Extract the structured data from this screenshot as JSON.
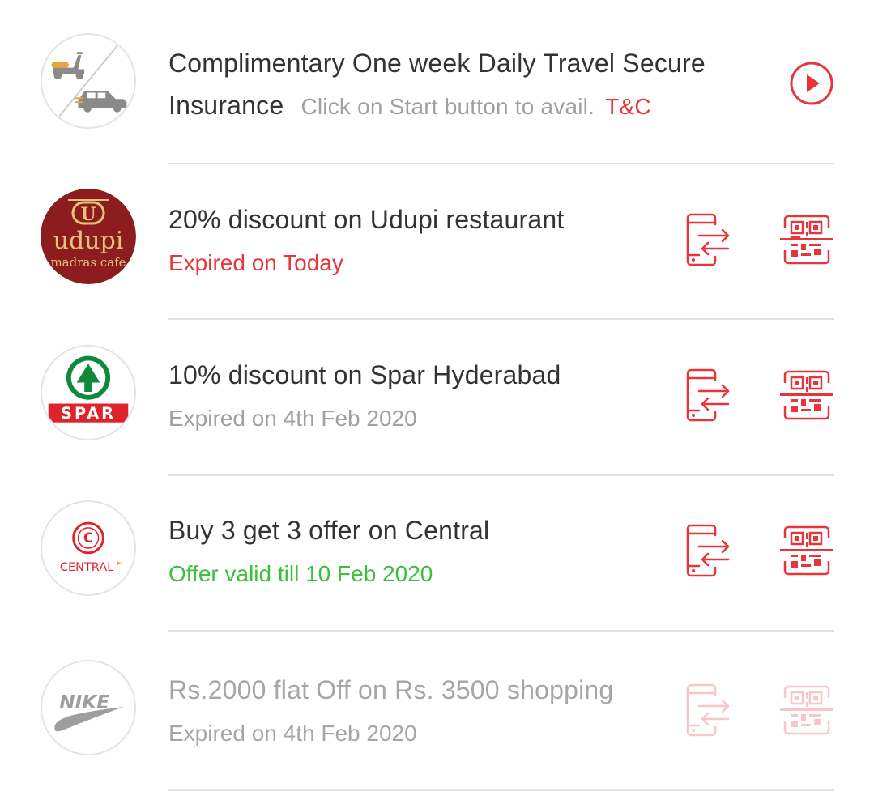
{
  "colors": {
    "accent": "#e8353b",
    "muted": "#a0a0a0",
    "valid": "#3cbf3c",
    "title": "#333333"
  },
  "offers": [
    {
      "logo": "travel-insurance-logo",
      "title_line1": "Complimentary One week Daily Travel Secure",
      "title_line2": "Insurance",
      "note": "Click on Start button to avail.",
      "tnc": "T&C",
      "action_icon": "play-icon"
    },
    {
      "logo": "udupi-logo",
      "logo_text_main": "udupi",
      "logo_text_sub": "madras cafe",
      "title": "20% discount on Udupi restaurant",
      "status": "Expired on Today",
      "status_kind": "expired-today",
      "action_icons": [
        "phone-transfer-icon",
        "qr-scan-icon"
      ]
    },
    {
      "logo": "spar-logo",
      "logo_text": "SPAR",
      "title": "10% discount on Spar Hyderabad",
      "status": "Expired on 4th Feb 2020",
      "status_kind": "expired",
      "action_icons": [
        "phone-transfer-icon",
        "qr-scan-icon"
      ]
    },
    {
      "logo": "central-logo",
      "logo_text": "CENTRAL",
      "title": "Buy 3 get 3 offer on Central",
      "status": "Offer valid till 10 Feb 2020",
      "status_kind": "valid",
      "action_icons": [
        "phone-transfer-icon",
        "qr-scan-icon"
      ]
    },
    {
      "logo": "nike-logo",
      "logo_text": "NIKE",
      "title": "Rs.2000 flat Off on Rs. 3500 shopping",
      "status": "Expired on 4th Feb 2020",
      "status_kind": "disabled",
      "action_icons": [
        "phone-transfer-icon",
        "qr-scan-icon"
      ]
    }
  ]
}
